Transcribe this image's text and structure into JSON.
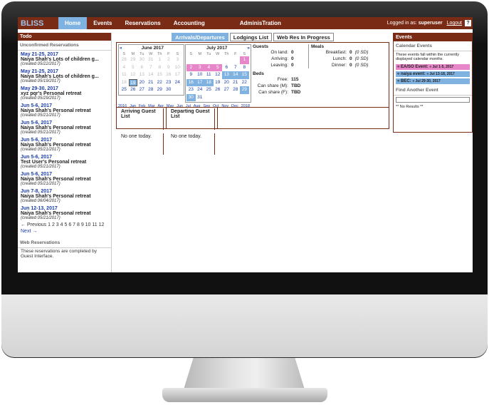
{
  "app": {
    "brand": "BLISS",
    "nav": [
      "Home",
      "Events",
      "Reservations",
      "Accounting"
    ],
    "admin": "AdminisTration",
    "logged_prefix": "Logged in as:",
    "user": "superuser",
    "logout": "Logout",
    "help": "?"
  },
  "todo": {
    "title": "Todo",
    "section": "Unconfirmed Reservations",
    "items": [
      {
        "date": "May 21-25, 2017",
        "name": "Naiya Shah's Lots of children g...",
        "created": "(created 05/22/2017)"
      },
      {
        "date": "May 21-25, 2017",
        "name": "Naiya Shah's Lots of children g...",
        "created": "(created 05/19/2017)"
      },
      {
        "date": "May 29-30, 2017",
        "name": "xyz pqr's Personal retreat",
        "created": "(created 05/29/2017)"
      },
      {
        "date": "Jun 5-6, 2017",
        "name": "Naiya Shah's Personal retreat",
        "created": "(created 05/21/2017)"
      },
      {
        "date": "Jun 5-6, 2017",
        "name": "Naiya Shah's Personal retreat",
        "created": "(created 05/21/2017)"
      },
      {
        "date": "Jun 5-6, 2017",
        "name": "Naiya Shah's Personal retreat",
        "created": "(created 05/21/2017)"
      },
      {
        "date": "Jun 5-6, 2017",
        "name": "Test User's Personal retreat",
        "created": "(created 05/21/2017)"
      },
      {
        "date": "Jun 5-6, 2017",
        "name": "Naiya Shah's Personal retreat",
        "created": "(created 05/21/2017)"
      },
      {
        "date": "Jun 7-8, 2017",
        "name": "Naiya Shah's Personal retreat",
        "created": "(created 06/04/2017)"
      },
      {
        "date": "Jun 12-13, 2017",
        "name": "Naiya Shah's Personal retreat",
        "created": "(created 05/21/2017)"
      }
    ],
    "pager": "← Previous 1 2 3 4 5 6 7 8 9 10 11 12",
    "next": "Next →",
    "web_title": "Web Reservations",
    "web_text": "These reservations are completed by Guest Interface."
  },
  "tabs": [
    "ArrIvals/Departures",
    "Lodgings List",
    "Web Res In Progress"
  ],
  "june": {
    "title": "June 2017",
    "days": [
      "S",
      "M",
      "Tu",
      "W",
      "Th",
      "F",
      "S"
    ],
    "cells": [
      "28",
      "29",
      "30",
      "31",
      "1",
      "2",
      "3",
      "4",
      "5",
      "6",
      "7",
      "8",
      "9",
      "10",
      "11",
      "12",
      "13",
      "14",
      "15",
      "16",
      "17",
      "18",
      "19",
      "20",
      "21",
      "22",
      "23",
      "24",
      "25",
      "26",
      "27",
      "28",
      "29",
      "30"
    ]
  },
  "july": {
    "title": "July 2017",
    "cells": [
      "",
      "",
      "",
      "",
      "",
      "",
      "1",
      "2",
      "3",
      "4",
      "5",
      "6",
      "7",
      "8",
      "9",
      "10",
      "11",
      "12",
      "13",
      "14",
      "15",
      "16",
      "17",
      "18",
      "19",
      "20",
      "21",
      "22",
      "23",
      "24",
      "25",
      "26",
      "27",
      "28",
      "29",
      "30",
      "31"
    ]
  },
  "months": [
    "2016",
    "Jan",
    "Feb",
    "Mar",
    "Apr",
    "May",
    "Jun",
    "Jul",
    "Aug",
    "Sep",
    "Oct",
    "Nov",
    "Dec",
    "2018"
  ],
  "guests": {
    "title": "Guests",
    "rows": [
      [
        "On land:",
        "0"
      ],
      [
        "Arriving:",
        "0"
      ],
      [
        "Leaving:",
        "0"
      ]
    ]
  },
  "meals": {
    "title": "Meals",
    "rows": [
      [
        "Breakfast:",
        "0",
        "(0 SD)"
      ],
      [
        "Lunch:",
        "0",
        "(0 SD)"
      ],
      [
        "Dinner:",
        "0",
        "(0 SD)"
      ]
    ]
  },
  "beds": {
    "title": "Beds",
    "rows": [
      [
        "Free:",
        "115"
      ],
      [
        "Can share (M):",
        "TBD"
      ],
      [
        "Can share (F):",
        "TBD"
      ]
    ]
  },
  "lists": {
    "arr": "Arriving Guest List",
    "dep": "Departing Guest List",
    "none": "No one today."
  },
  "events": {
    "title": "Events",
    "cal": "Calendar Events",
    "note": "These events fall within the currently displayed calendar months.",
    "items": [
      {
        "name": "« EA/SO Event:",
        "date": "« Jul 1-5, 2017"
      },
      {
        "name": "« naiya event:",
        "date": "« Jul 13-18, 2017"
      },
      {
        "name": "« BEC:",
        "date": "« Jul 29-30, 2017"
      }
    ],
    "find": "Find Another Event",
    "noresults": "** No Results **"
  }
}
